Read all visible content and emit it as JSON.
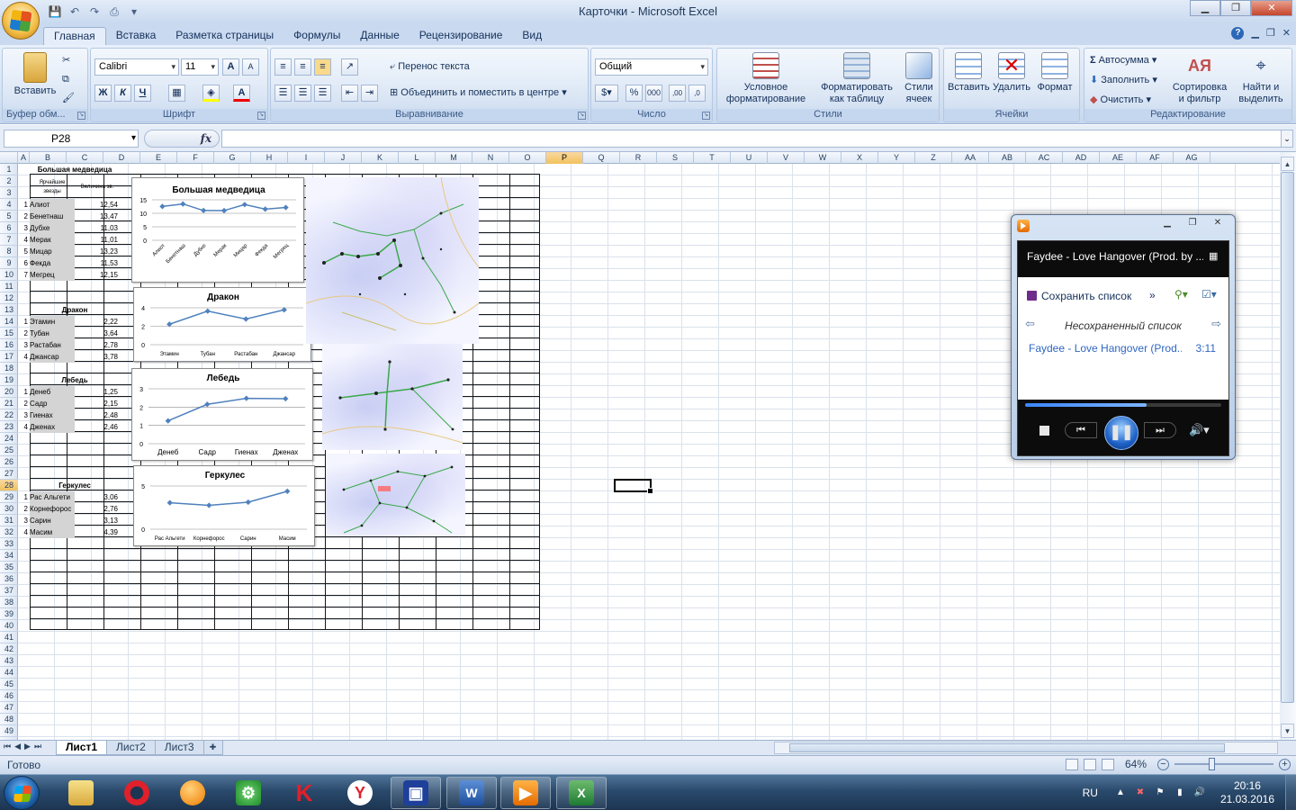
{
  "window": {
    "title": "Карточки - Microsoft Excel",
    "minimize": "▁",
    "maximize": "❐",
    "close": "✕"
  },
  "qat": {
    "save": "💾",
    "undo": "↶",
    "redo": "↷",
    "preview": "⎙",
    "more": "▾"
  },
  "tabs": [
    {
      "label": "Главная",
      "active": true
    },
    {
      "label": "Вставка"
    },
    {
      "label": "Разметка страницы"
    },
    {
      "label": "Формулы"
    },
    {
      "label": "Данные"
    },
    {
      "label": "Рецензирование"
    },
    {
      "label": "Вид"
    }
  ],
  "ribbon": {
    "clipboard": {
      "label": "Буфер обм...",
      "paste": "Вставить"
    },
    "font": {
      "label": "Шрифт",
      "name": "Calibri",
      "size": "11",
      "bold": "Ж",
      "italic": "К",
      "underline": "Ч",
      "grow": "A",
      "shrink": "A",
      "fontcolor": "A"
    },
    "alignment": {
      "label": "Выравнивание",
      "wrap": "Перенос текста",
      "merge": "Объединить и поместить в центре"
    },
    "number": {
      "label": "Число",
      "format": "Общий",
      "percent": "%",
      "thousands": "000",
      "inc": ",00",
      "dec": ",0"
    },
    "styles": {
      "label": "Стили",
      "cond": "Условное форматирование",
      "table": "Форматировать как таблицу",
      "cell": "Стили ячеек"
    },
    "cells": {
      "label": "Ячейки",
      "insert": "Вставить",
      "delete": "Удалить",
      "format": "Формат"
    },
    "editing": {
      "label": "Редактирование",
      "autosum": "Автосумма",
      "fill": "Заполнить",
      "clear": "Очистить",
      "sort": "Сортировка и фильтр",
      "find": "Найти и выделить"
    }
  },
  "formula": {
    "namebox": "P28",
    "fx": "fx",
    "value": ""
  },
  "columns": [
    "A",
    "B",
    "C",
    "D",
    "E",
    "F",
    "G",
    "H",
    "I",
    "J",
    "K",
    "L",
    "M",
    "N",
    "O",
    "P",
    "Q",
    "R",
    "S",
    "T",
    "U",
    "V",
    "W",
    "X",
    "Y",
    "Z",
    "AA",
    "AB",
    "AC",
    "AD",
    "AE",
    "AF",
    "AG"
  ],
  "active_column": "P",
  "active_row": 28,
  "rows_count": 49,
  "sheet": {
    "ursa": {
      "title": "Большая медведица",
      "head_stars": "Ярчайшие звезды",
      "head_mag": "Величина зв.",
      "stars": [
        {
          "n": "1",
          "name": "Алиот",
          "v": "12,54"
        },
        {
          "n": "2",
          "name": "Бенетнаш",
          "v": "13,47"
        },
        {
          "n": "3",
          "name": "Дубхе",
          "v": "11,03"
        },
        {
          "n": "4",
          "name": "Мерак",
          "v": "11,01"
        },
        {
          "n": "5",
          "name": "Мицар",
          "v": "13,23"
        },
        {
          "n": "6",
          "name": "Фекда",
          "v": "11,53"
        },
        {
          "n": "7",
          "name": "Мегрец",
          "v": "12,15"
        }
      ]
    },
    "draco": {
      "title": "Дракон",
      "stars": [
        {
          "n": "1",
          "name": "Этамин",
          "v": "2,22"
        },
        {
          "n": "2",
          "name": "Тубан",
          "v": "3,64"
        },
        {
          "n": "3",
          "name": "Растабан",
          "v": "2,78"
        },
        {
          "n": "4",
          "name": "Джансар",
          "v": "3,78"
        }
      ]
    },
    "cygnus": {
      "title": "Лебедь",
      "stars": [
        {
          "n": "1",
          "name": "Денеб",
          "v": "1,25"
        },
        {
          "n": "2",
          "name": "Садр",
          "v": "2,15"
        },
        {
          "n": "3",
          "name": "Гиенах",
          "v": "2,48"
        },
        {
          "n": "4",
          "name": "Дженах",
          "v": "2,46"
        }
      ]
    },
    "hercules": {
      "title": "Геркулес",
      "stars": [
        {
          "n": "1",
          "name": "Рас Альгети",
          "v": "3,06"
        },
        {
          "n": "2",
          "name": "Корнефорос",
          "v": "2,76"
        },
        {
          "n": "3",
          "name": "Сарин",
          "v": "3,13"
        },
        {
          "n": "4",
          "name": "Масим",
          "v": "4,39"
        }
      ]
    }
  },
  "chart_data": [
    {
      "type": "line",
      "title": "Большая медведица",
      "categories": [
        "Алиот",
        "Бенетнаш",
        "Дубхе",
        "Мерак",
        "Мицар",
        "Фекда",
        "Мегрец"
      ],
      "values": [
        12.54,
        13.47,
        11.03,
        11.01,
        13.23,
        11.53,
        12.15
      ],
      "ylim": [
        0,
        15
      ],
      "yticks": [
        0,
        5,
        10,
        15
      ],
      "grid": true,
      "color": "#4f81bd"
    },
    {
      "type": "line",
      "title": "Дракон",
      "categories": [
        "Этамин",
        "Тубан",
        "Растабан",
        "Джансар"
      ],
      "values": [
        2.22,
        3.64,
        2.78,
        3.78
      ],
      "ylim": [
        0,
        4
      ],
      "yticks": [
        0,
        2,
        4
      ],
      "grid": true,
      "color": "#4f81bd"
    },
    {
      "type": "line",
      "title": "Лебедь",
      "categories": [
        "Денеб",
        "Садр",
        "Гиенах",
        "Дженах"
      ],
      "values": [
        1.25,
        2.15,
        2.48,
        2.46
      ],
      "ylim": [
        0,
        3
      ],
      "yticks": [
        0,
        1,
        2,
        3
      ],
      "grid": true,
      "color": "#4f81bd"
    },
    {
      "type": "line",
      "title": "Геркулес",
      "categories": [
        "Рас Альгети",
        "Корнефорос",
        "Сарин",
        "Масим"
      ],
      "values": [
        3.06,
        2.76,
        3.13,
        4.39
      ],
      "ylim": [
        0,
        5
      ],
      "yticks": [
        0,
        5
      ],
      "grid": true,
      "color": "#4f81bd"
    }
  ],
  "sheet_tabs": [
    {
      "label": "Лист1",
      "active": true
    },
    {
      "label": "Лист2"
    },
    {
      "label": "Лист3"
    }
  ],
  "status": {
    "ready": "Готово",
    "zoom": "64%"
  },
  "media_player": {
    "track": "Faydee - Love Hangover (Prod. by ...",
    "save_list": "Сохранить список",
    "more": "»",
    "list_name": "Несохраненный список",
    "item_title": "Faydee - Love Hangover (Prod...",
    "item_duration": "3:11",
    "progress": 0.62
  },
  "taskbar": {
    "lang": "RU",
    "time": "20:16",
    "date": "21.03.2016"
  }
}
